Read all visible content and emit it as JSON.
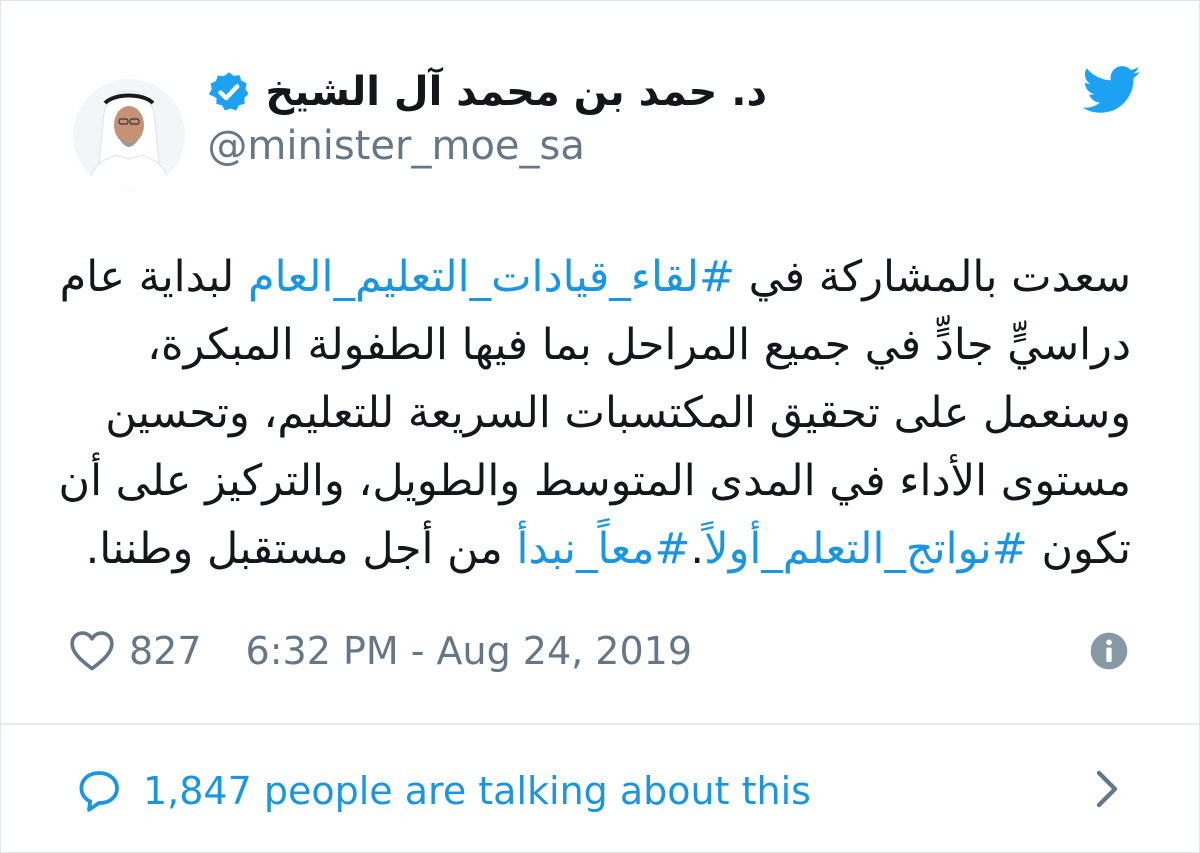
{
  "user": {
    "display_name": "د. حمد بن محمد آل الشيخ",
    "handle": "@minister_moe_sa",
    "verified": true
  },
  "icons": {
    "brand": "twitter-bird-icon",
    "verified": "verified-badge-icon",
    "like": "heart-icon",
    "info": "info-icon",
    "reply": "reply-bubble-icon",
    "chevron": "chevron-right-icon"
  },
  "tweet": {
    "lines": [
      [
        {
          "text": "سعدت بالمشاركة في ",
          "hashtag": false
        },
        {
          "text": "#لقاء_قيادات_التعليم_العام",
          "hashtag": true
        },
        {
          "text": " لبداية عام",
          "hashtag": false
        }
      ],
      [
        {
          "text": "دراسيٍّ جادٍّ في جميع المراحل بما فيها الطفولة المبكرة،",
          "hashtag": false
        }
      ],
      [
        {
          "text": "وسنعمل على تحقيق المكتسبات السريعة للتعليم، وتحسين",
          "hashtag": false
        }
      ],
      [
        {
          "text": "مستوى الأداء في المدى المتوسط والطويل، والتركيز على أن",
          "hashtag": false
        }
      ],
      [
        {
          "text": "تكون ",
          "hashtag": false
        },
        {
          "text": "#نواتج_التعلم_أولاً",
          "hashtag": true
        },
        {
          "text": ".",
          "hashtag": false
        },
        {
          "text": "#معاً_نبدأ",
          "hashtag": true
        },
        {
          "text": " من أجل مستقبل وطننا.",
          "hashtag": false
        }
      ]
    ]
  },
  "meta": {
    "likes": "827",
    "timestamp": "6:32 PM - Aug 24, 2019"
  },
  "footer": {
    "talking": "1,847 people are talking about this"
  },
  "colors": {
    "brand_blue": "#1da1f2",
    "link_blue": "#1b95e0",
    "text_dark": "#14171a",
    "text_gray": "#657786",
    "border": "#e6ecf0"
  }
}
